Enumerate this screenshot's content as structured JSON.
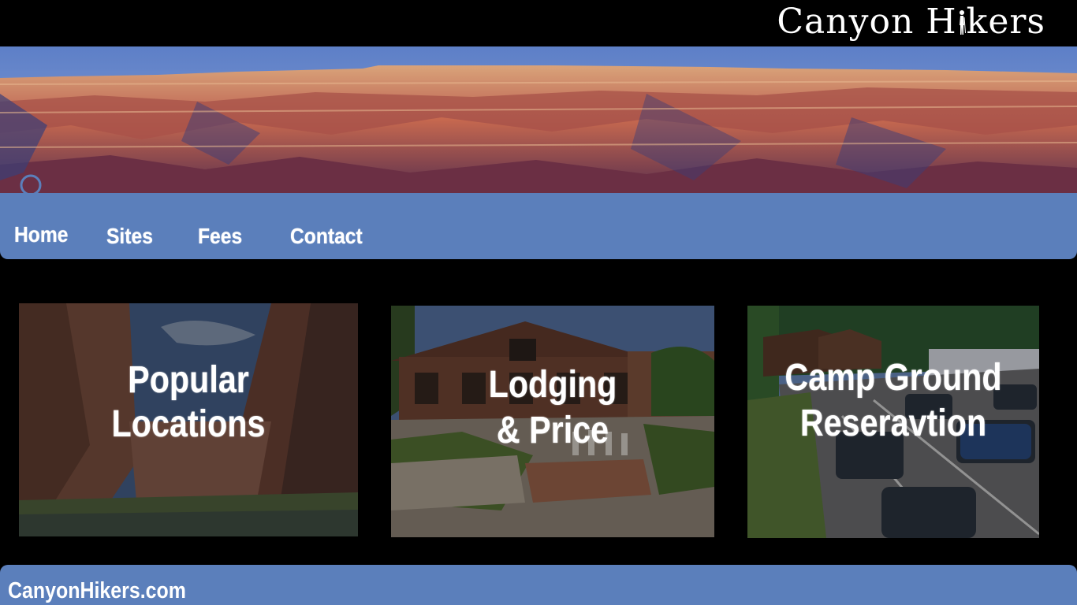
{
  "header": {
    "logo_part1": "Canyon H",
    "logo_part2": "kers",
    "logo_text": "Canyon Hikers"
  },
  "nav": {
    "items": [
      {
        "label": "Home"
      },
      {
        "label": "Sites"
      },
      {
        "label": "Fees"
      },
      {
        "label": "Contact"
      }
    ]
  },
  "cards": [
    {
      "line1": "Popular",
      "line2": "Locations"
    },
    {
      "line1": "Lodging",
      "line2": "& Price"
    },
    {
      "line1": "Camp Ground",
      "line2": "Reseravtion"
    }
  ],
  "footer": {
    "site": "CanyonHikers.com"
  },
  "colors": {
    "background": "#000000",
    "accent": "#5b7fbb",
    "text": "#ffffff"
  }
}
